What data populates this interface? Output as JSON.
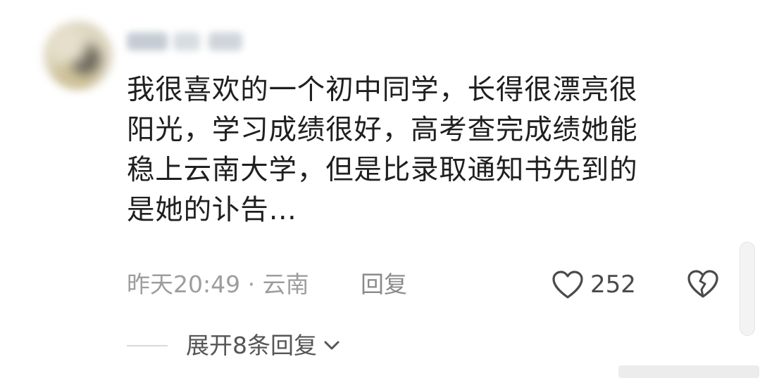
{
  "comment": {
    "lines": [
      "我很喜欢的一个初中同学，长得很漂亮很",
      "阳光，学习成绩很好，高考查完成绩她能",
      "稳上云南大学，但是比录取通知书先到的",
      "是她的讣告…"
    ],
    "timestamp": "昨天20:49",
    "separator": "·",
    "location": "云南",
    "reply_label": "回复",
    "like_count": "252",
    "expand_label": "展开8条回复"
  },
  "icons": {
    "like": "heart-outline-icon",
    "dislike": "broken-heart-icon",
    "expand": "chevron-down-icon"
  },
  "colors": {
    "text": "#1f1f1f",
    "meta": "#9d9d9d",
    "icon": "#4a4a4a"
  }
}
